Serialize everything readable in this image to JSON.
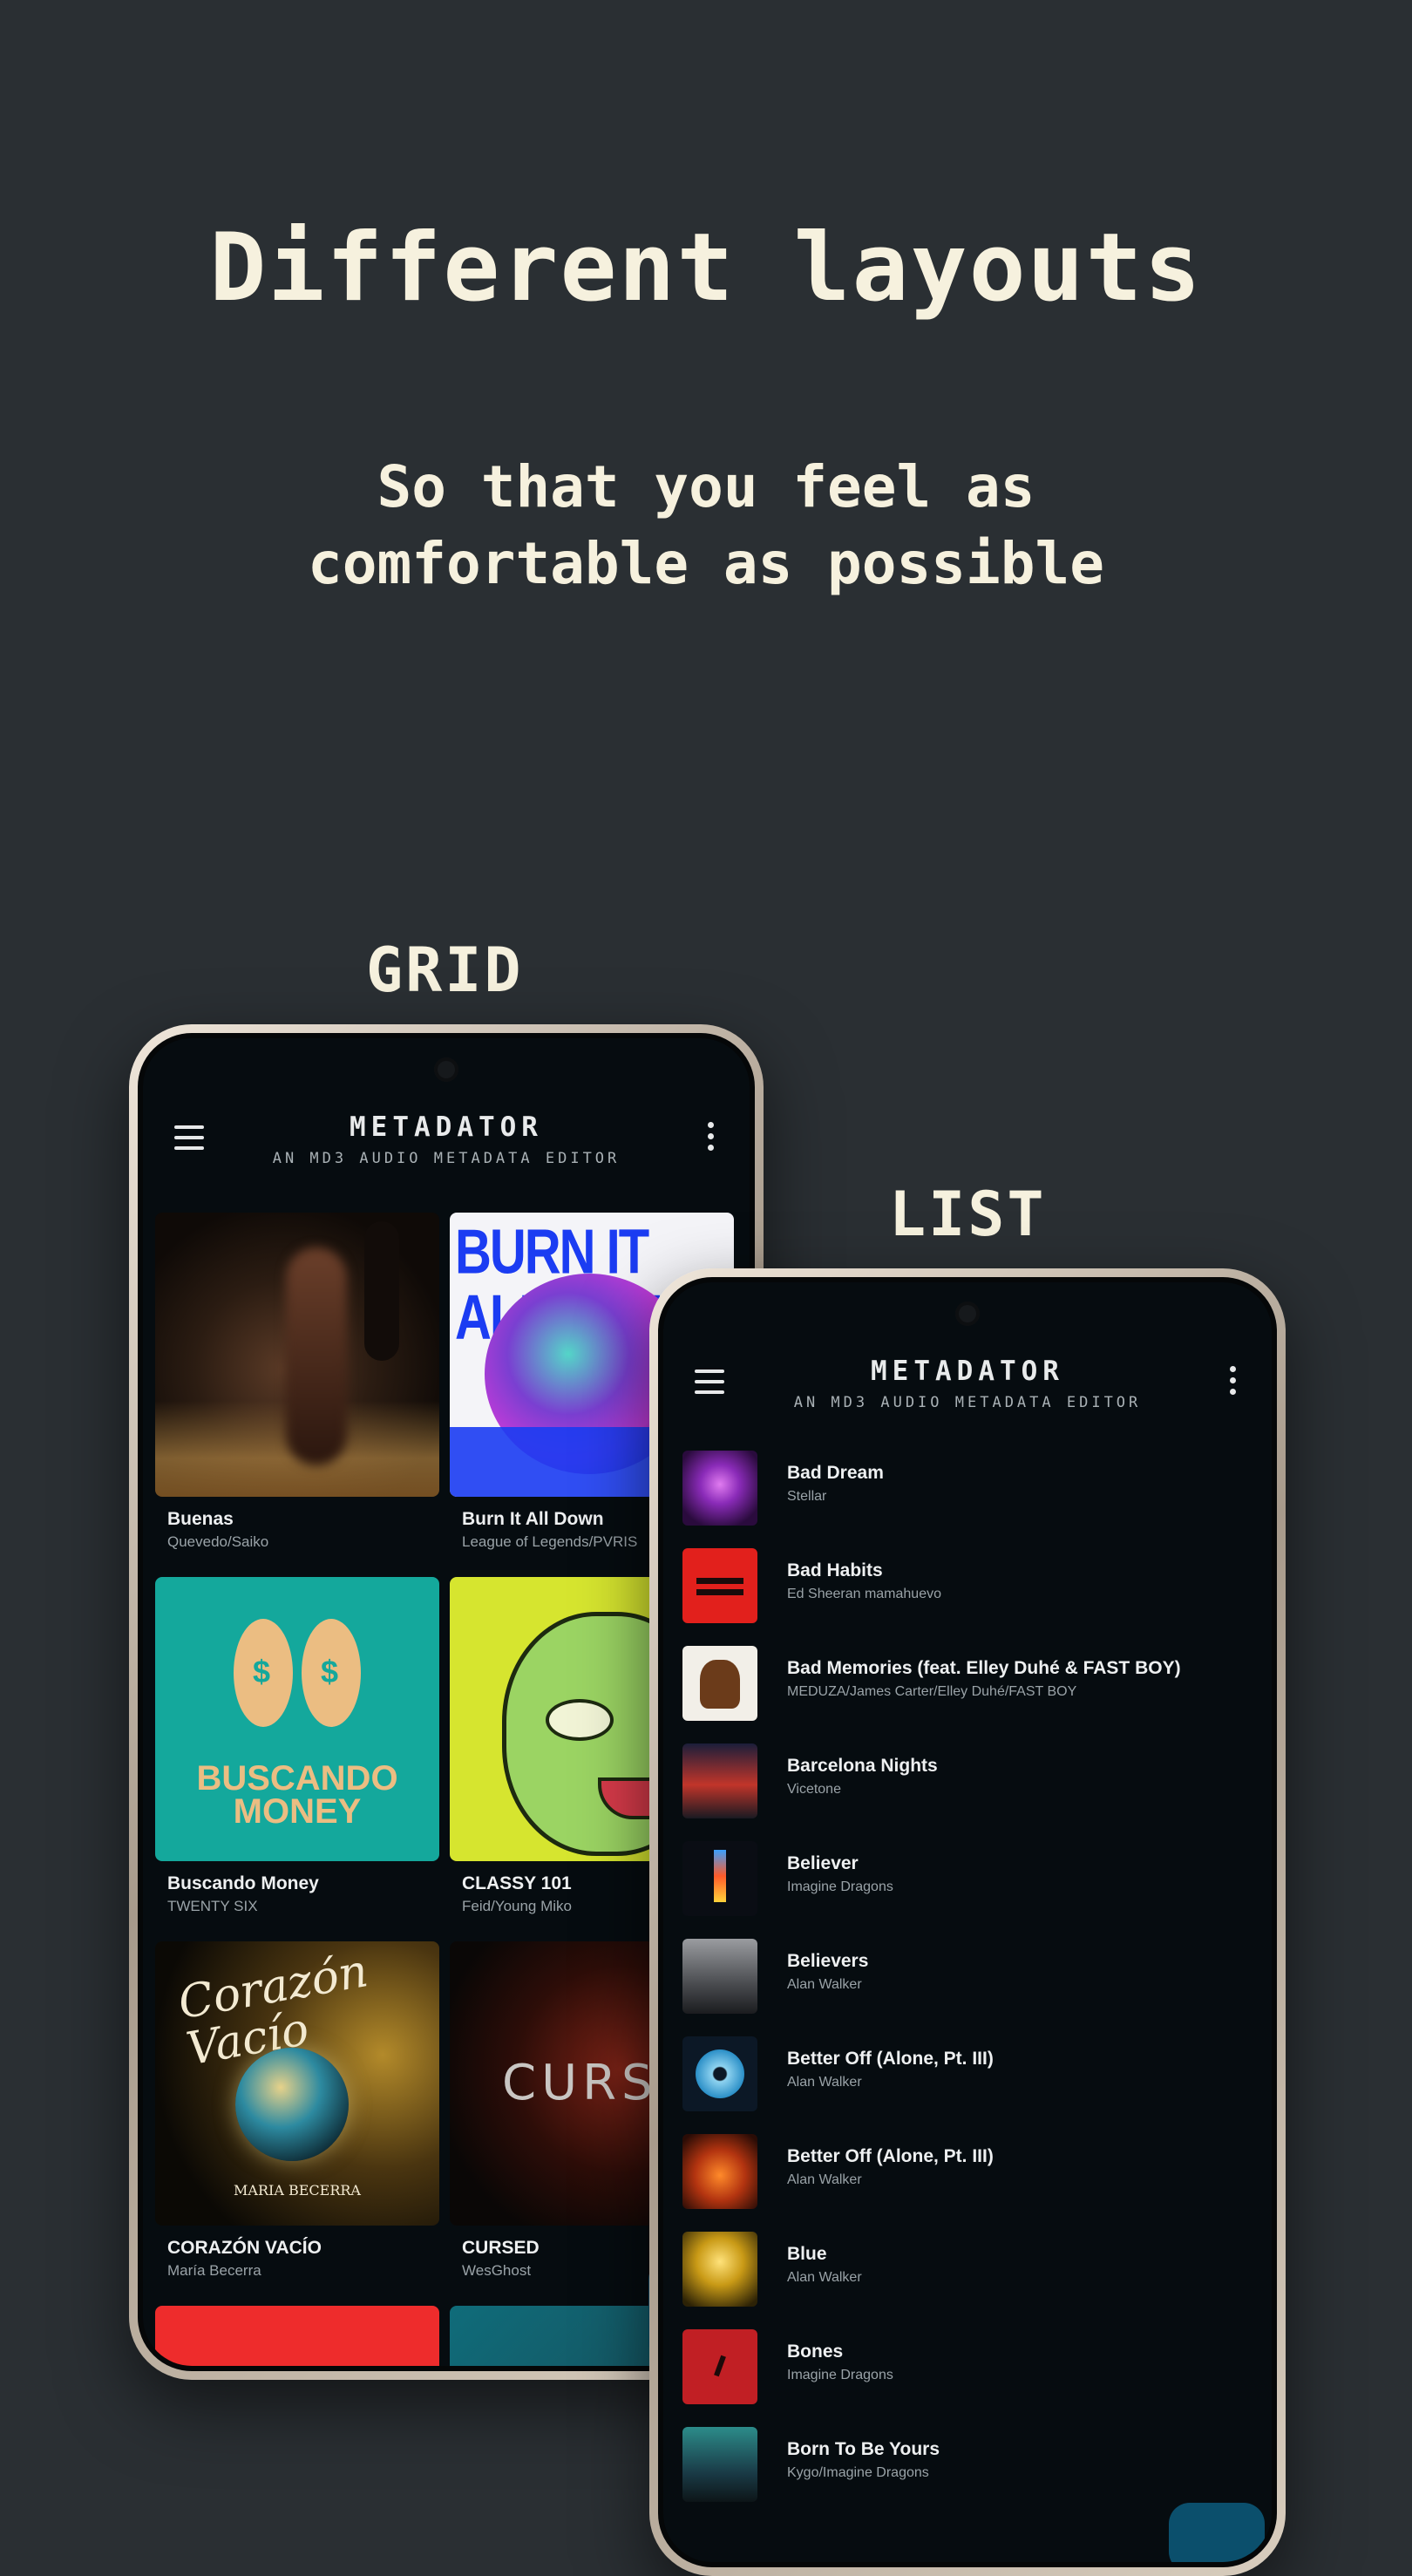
{
  "headline": "Different layouts",
  "subline": "So that you feel as\ncomfortable as possible",
  "labels": {
    "grid": "GRID",
    "list": "LIST"
  },
  "app": {
    "title": "METADATOR",
    "subtitle": "AN MD3 AUDIO METADATA EDITOR"
  },
  "colors": {
    "background": "#2a2f33",
    "headline": "#f6f1de",
    "screen": "#060c10",
    "fab": "#0b4f6c"
  },
  "grid": [
    {
      "title": "Buenas",
      "artist": "Quevedo/Saiko"
    },
    {
      "title": "Burn It All Down",
      "artist": "League of Legends/PVRIS",
      "art_text": "BURN IT ALL DOWN"
    },
    {
      "title": "Buscando Money",
      "artist": "TWENTY SIX",
      "art_text": "BUSCANDO MONEY"
    },
    {
      "title": "CLASSY 101",
      "artist": "Feid/Young Miko"
    },
    {
      "title": "CORAZÓN VACÍO",
      "artist": "María Becerra",
      "art_text": "Corazón Vacío",
      "art_caption": "MARIA BECERRA"
    },
    {
      "title": "CURSED",
      "artist": "WesGhost",
      "art_text": "CURSED"
    }
  ],
  "list": [
    {
      "title": "Bad Dream",
      "artist": "Stellar"
    },
    {
      "title": "Bad Habits",
      "artist": "Ed Sheeran mamahuevo"
    },
    {
      "title": "Bad Memories (feat. Elley Duhé & FAST BOY)",
      "artist": "MEDUZA/James Carter/Elley Duhé/FAST BOY"
    },
    {
      "title": "Barcelona Nights",
      "artist": "Vicetone"
    },
    {
      "title": "Believer",
      "artist": "Imagine Dragons"
    },
    {
      "title": "Believers",
      "artist": "Alan Walker"
    },
    {
      "title": "Better Off (Alone, Pt. III)",
      "artist": "Alan Walker"
    },
    {
      "title": "Better Off (Alone, Pt. III)",
      "artist": "Alan Walker"
    },
    {
      "title": "Blue",
      "artist": "Alan Walker"
    },
    {
      "title": "Bones",
      "artist": "Imagine Dragons"
    },
    {
      "title": "Born To Be Yours",
      "artist": "Kygo/Imagine Dragons"
    }
  ]
}
